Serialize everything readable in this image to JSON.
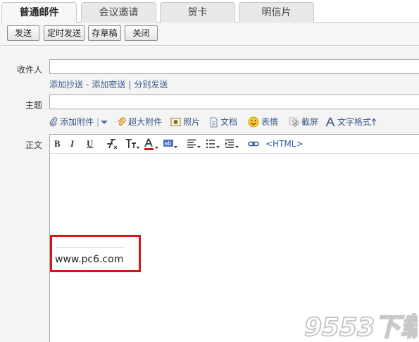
{
  "tabs": [
    {
      "label": "普通邮件",
      "active": true
    },
    {
      "label": "会议邀请",
      "active": false
    },
    {
      "label": "贺卡",
      "active": false
    },
    {
      "label": "明信片",
      "active": false
    }
  ],
  "toolbar": {
    "send": "发送",
    "scheduled_send": "定时发送",
    "save_draft": "存草稿",
    "close": "关闭"
  },
  "form": {
    "recipient_label": "收件人",
    "recipient_value": "",
    "recipient_links": {
      "add_cc": "添加抄送",
      "add_bcc": "添加密送",
      "separate": "分别发送",
      "dash": "-",
      "bar": "|"
    },
    "subject_label": "主题",
    "subject_value": "",
    "attach_bar": {
      "add_attachment": "添加附件",
      "bar": "|",
      "large_attachment": "超大附件",
      "photo": "照片",
      "document": "文档",
      "emoji": "表情",
      "screenshot": "截屏",
      "text_format": "文字格式"
    },
    "body_label": "正文"
  },
  "editor": {
    "toolbar": {
      "bold": "B",
      "italic": "I",
      "underline": "U",
      "html": "<HTML>"
    },
    "signature": {
      "line": "————————————",
      "text": "www.pc6.com"
    }
  },
  "watermark": {
    "text": "9553下载"
  },
  "colors": {
    "link": "#3a5a8c",
    "highlight_border": "#d9141b",
    "tab_active_bg": "#f7f7f7"
  }
}
